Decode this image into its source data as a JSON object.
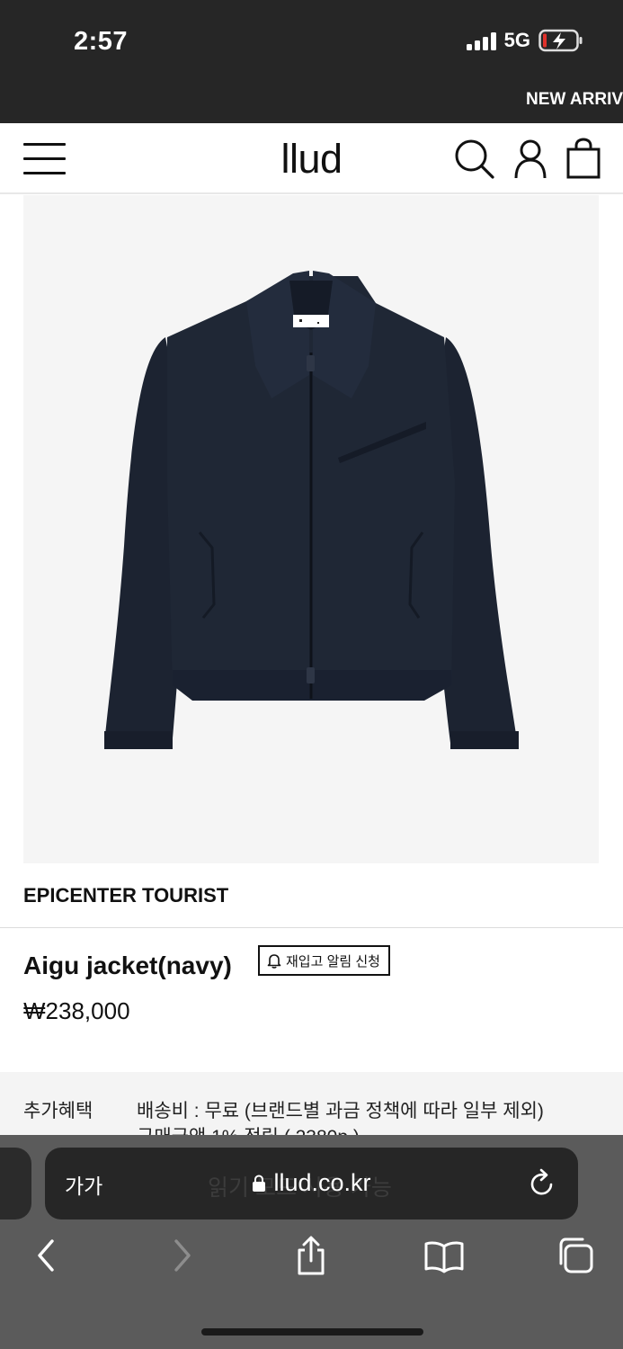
{
  "status_bar": {
    "time": "2:57",
    "network": "5G",
    "battery_state": "charging"
  },
  "marquee": {
    "text": "NEW ARRIV"
  },
  "header": {
    "logo": "llud",
    "icons": [
      "menu-icon",
      "search-icon",
      "account-icon",
      "shopping-bag-icon"
    ]
  },
  "product": {
    "image_alt_icon": "navy-zip-jacket",
    "brand": "EPICENTER TOURIST",
    "name": "Aigu jacket(navy)",
    "restock_button": "재입고 알림 신청",
    "price": "₩238,000",
    "benefits": {
      "label": "추가혜택",
      "shipping": "배송비 : 무료 (브랜드별 과금 정책에 따라 일부 제외)",
      "points": "구매금액 1% 적립 ( 2380p )"
    }
  },
  "browser": {
    "reader_button": "가가",
    "ghost_text": "읽기 모드 사용 가능",
    "url": "llud.co.kr",
    "toolbar": [
      "back-icon",
      "forward-icon",
      "share-icon",
      "bookmarks-icon",
      "tabs-icon"
    ]
  },
  "colors": {
    "status_bg": "#262626",
    "jacket_navy": "#1f2735",
    "image_bg": "#f5f5f5",
    "browser_bar": "#5b5b5b",
    "battery_red": "#e0312b"
  }
}
